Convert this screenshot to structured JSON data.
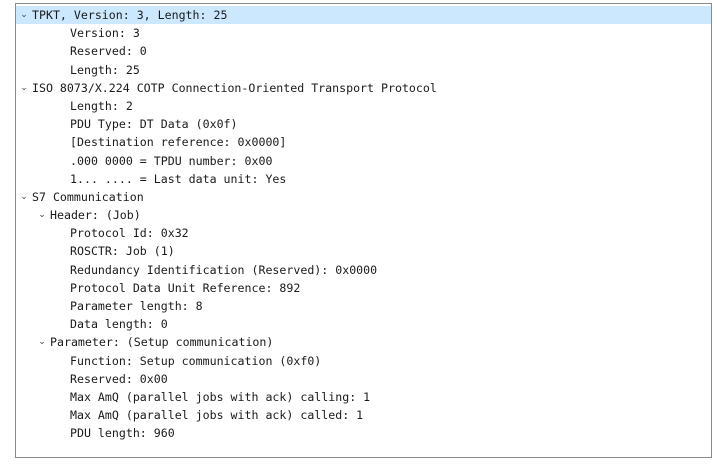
{
  "tree": {
    "tpkt": {
      "header": "TPKT, Version: 3, Length: 25",
      "items": [
        "Version: 3",
        "Reserved: 0",
        "Length: 25"
      ]
    },
    "cotp": {
      "header": "ISO 8073/X.224 COTP Connection-Oriented Transport Protocol",
      "items": [
        "Length: 2",
        "PDU Type: DT Data (0x0f)",
        "[Destination reference: 0x0000]",
        ".000 0000 = TPDU number: 0x00",
        "1... .... = Last data unit: Yes"
      ]
    },
    "s7": {
      "header": "S7 Communication",
      "header_section": {
        "label": "Header: (Job)",
        "items": [
          "Protocol Id: 0x32",
          "ROSCTR: Job (1)",
          "Redundancy Identification (Reserved): 0x0000",
          "Protocol Data Unit Reference: 892",
          "Parameter length: 8",
          "Data length: 0"
        ]
      },
      "parameter_section": {
        "label": "Parameter: (Setup communication)",
        "items": [
          "Function: Setup communication (0xf0)",
          "Reserved: 0x00",
          "Max AmQ (parallel jobs with ack) calling: 1",
          "Max AmQ (parallel jobs with ack) called: 1",
          "PDU length: 960"
        ]
      }
    }
  },
  "icons": {
    "expanded": "chevron-down-icon"
  },
  "colors": {
    "selected_row": "#cce8ff",
    "frame_border": "#8a8a8a",
    "text": "#1a1a1a"
  }
}
